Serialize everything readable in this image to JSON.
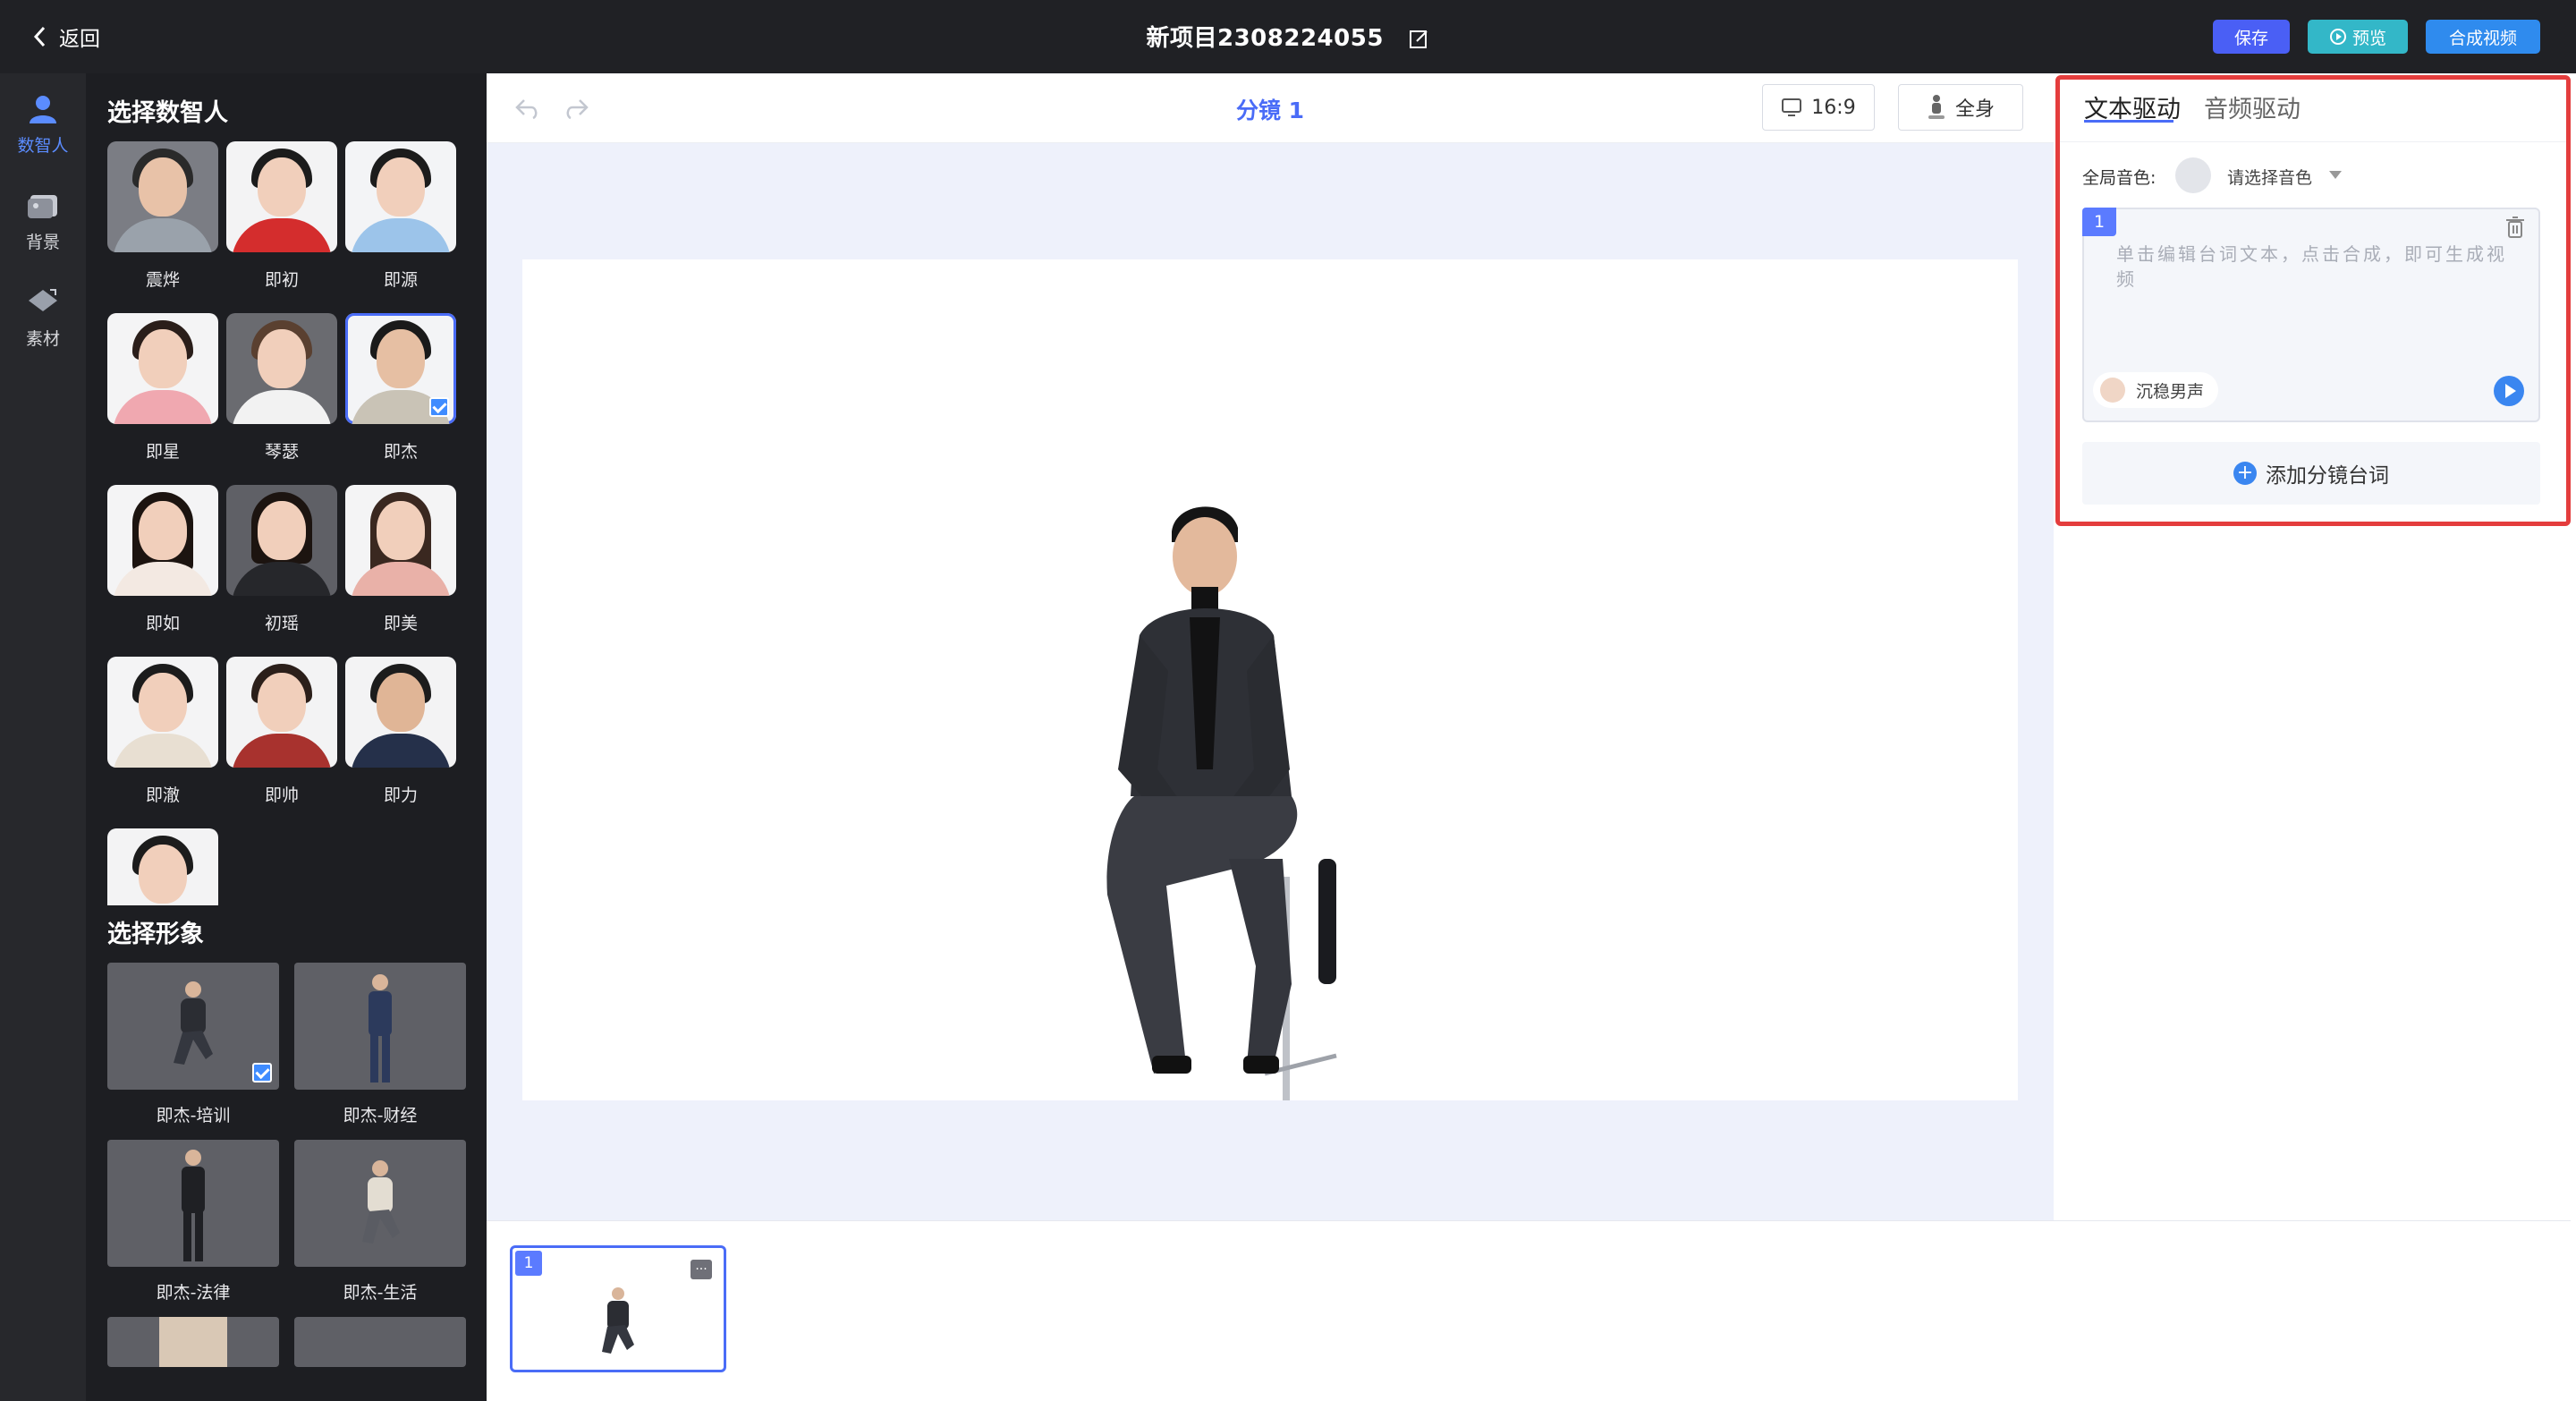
{
  "topbar": {
    "back_label": "返回",
    "project_title": "新项目2308224055",
    "save_label": "保存",
    "preview_label": "预览",
    "compose_label": "合成视频"
  },
  "rail": {
    "items": [
      {
        "label": "数智人",
        "icon": "person-icon",
        "active": true
      },
      {
        "label": "背景",
        "icon": "image-icon",
        "active": false
      },
      {
        "label": "素材",
        "icon": "material-icon",
        "active": false
      }
    ]
  },
  "panel": {
    "avatars_heading": "选择数智人",
    "avatars": [
      {
        "name": "震烨"
      },
      {
        "name": "即初"
      },
      {
        "name": "即源"
      },
      {
        "name": "即星"
      },
      {
        "name": "琴瑟"
      },
      {
        "name": "即杰",
        "selected": true
      },
      {
        "name": "即如"
      },
      {
        "name": "初瑶"
      },
      {
        "name": "即美"
      },
      {
        "name": "即澈"
      },
      {
        "name": "即帅"
      },
      {
        "name": "即力"
      },
      {
        "name": ""
      }
    ],
    "figures_heading": "选择形象",
    "figures": [
      {
        "name": "即杰-培训",
        "selected": true
      },
      {
        "name": "即杰-财经"
      },
      {
        "name": "即杰-法律"
      },
      {
        "name": "即杰-生活"
      },
      {
        "name": ""
      },
      {
        "name": ""
      }
    ]
  },
  "canvas": {
    "scene_title": "分镜 1",
    "ratio_label": "16:9",
    "body_label": "全身"
  },
  "right": {
    "tab_text": "文本驱动",
    "tab_audio": "音频驱动",
    "global_voice_label": "全局音色:",
    "voice_select_placeholder": "请选择音色",
    "line_number": "1",
    "script_placeholder": "单击编辑台词文本，点击合成，即可生成视频",
    "voice_name": "沉稳男声",
    "add_line_label": "添加分镜台词"
  },
  "timeline": {
    "clip_number": "1",
    "more_label": "···"
  },
  "colors": {
    "accent": "#4a6cf7",
    "save": "#4a5ff5",
    "preview": "#33b7c8",
    "compose": "#2f8bee",
    "highlight_frame": "#e43d3d"
  }
}
